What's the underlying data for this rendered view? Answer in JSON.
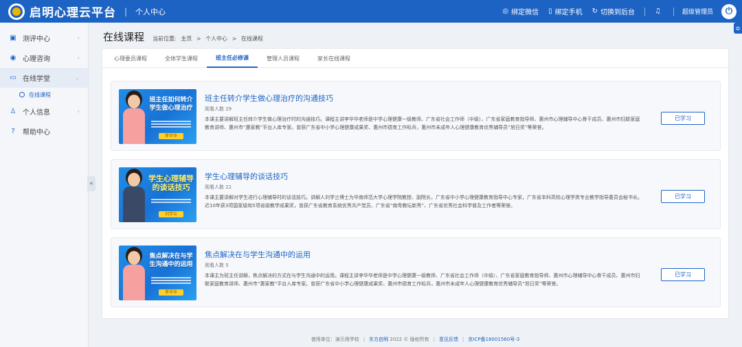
{
  "app": {
    "brand": "启明心理云平台",
    "subtitle": "个人中心"
  },
  "topbar": {
    "wechat": "绑定微信",
    "phone": "绑定手机",
    "switch": "切换到后台",
    "user": "超级管理员"
  },
  "sidebar": {
    "items": [
      {
        "label": "测评中心",
        "icon": "clipboard-icon"
      },
      {
        "label": "心理咨询",
        "icon": "chat-icon"
      },
      {
        "label": "在线学堂",
        "icon": "monitor-icon"
      },
      {
        "label": "个人信息",
        "icon": "user-icon"
      },
      {
        "label": "帮助中心",
        "icon": "help-icon"
      }
    ],
    "sub_item": "在线课程"
  },
  "page": {
    "title": "在线课程",
    "breadcrumb": {
      "prefix": "当前位置:",
      "home": "主页",
      "sep": ">",
      "center": "个人中心",
      "current": "在线课程"
    }
  },
  "tabs": [
    "心理委员课程",
    "全体学生课程",
    "班主任必修课",
    "管理人员课程",
    "家长在线课程"
  ],
  "courses": [
    {
      "thumb_title": "班主任如何转介学生做心理治疗",
      "thumb_tag": "李华华",
      "title": "班主任转介学生做心理治疗的沟通技巧",
      "views": "观看人数 29",
      "desc": "本课主要讲解班主任转介学生做心理治疗时的沟通技巧。课程主讲李华华老师是中学心理健康一级教师、广东省社会工作师（中级）、广东省家庭教育指导师、惠州市心理辅导中心骨干成员、惠州市妇联家庭教育讲师、惠州市“惠家教”平台入库专家。曾获广东省中小学心理健康成果奖、惠州市德育工作标兵，惠州市未成年人心理健康教育优秀辅导员“旭日奖”等荣誉。",
      "button": "已学习"
    },
    {
      "thumb_title": "学生心理辅导的谈话技巧",
      "thumb_tag": "刘学兰",
      "title": "学生心理辅导的谈话技巧",
      "views": "观看人数 22",
      "desc": "本课主要讲解对学生进行心理辅导时的谈话技巧。讲解人刘学兰博士为华南师范大学心理学院教授、副院长，广东省中小学心理健康教育指导中心专家，广东省本科高校心理学类专业教学指导委员会秘书长。近10年获3项国家级和5项省级教学成果奖，曾获广东省教育系统优秀共产党员、广东省“南粤教坛新秀”、广东省优秀社会科学普及工作者等荣誉。",
      "button": "已学习"
    },
    {
      "thumb_title": "焦点解决在与学生沟通中的运用",
      "thumb_tag": "李华华",
      "title": "焦点解决在与学生沟通中的运用",
      "views": "观看人数 5",
      "desc": "本课主为班主任讲解，焦点解决的方式在与学生沟通中的运用。课程主讲李华华老师是中学心理健康一级教师、广东省社会工作师（中级）、广东省家庭教育指导师、惠州市心理辅导中心骨干成员、惠州市妇联家庭教育讲师、惠州市“惠家教”平台入库专家。曾获广东省中小学心理健康成果奖、惠州市德育工作标兵，惠州市未成年人心理健康教育优秀辅导员“旭日奖”等荣誉。",
      "button": "已学习"
    }
  ],
  "footer": {
    "unit": "使用单位：演示用学校",
    "company": "东方启明",
    "copyright": "2022 © 版权所有",
    "feedback": "意见反馈",
    "icp": "京ICP备18001560号-3"
  },
  "colors": {
    "primary": "#1d63c4",
    "background": "#eef1f5"
  }
}
